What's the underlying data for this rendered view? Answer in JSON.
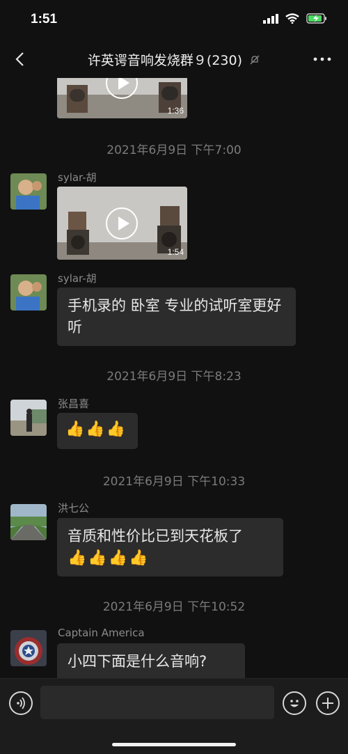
{
  "status": {
    "time": "1:51"
  },
  "header": {
    "title": "许英谔音响发烧群９(230)"
  },
  "messages": {
    "video0": {
      "duration": "1:36"
    },
    "ts1": "2021年6月9日 下午7:00",
    "msg1": {
      "sender": "sylar-胡",
      "duration": "1:54"
    },
    "msg2": {
      "sender": "sylar-胡",
      "text": "手机录的 卧室 专业的试听室更好听"
    },
    "ts2": "2021年6月9日 下午8:23",
    "msg3": {
      "sender": "张昌喜",
      "text": "👍👍👍"
    },
    "ts3": "2021年6月9日 下午10:33",
    "msg4": {
      "sender": "洪七公",
      "text": "音质和性价比已到天花板了",
      "emoji": "👍👍👍👍"
    },
    "ts4": "2021年6月9日 下午10:52",
    "msg5": {
      "sender": "Captain America",
      "text": "小四下面是什么音响?"
    }
  },
  "colors": {
    "background": "#111111",
    "bubble": "#2c2c2c",
    "timestamp": "#7b7b7b",
    "battery": "#4cd964"
  },
  "icons": [
    "back-icon",
    "mute-icon",
    "more-icon",
    "voice-icon",
    "emoji-icon",
    "plus-icon",
    "play-icon",
    "signal-icon",
    "wifi-icon",
    "battery-icon"
  ]
}
